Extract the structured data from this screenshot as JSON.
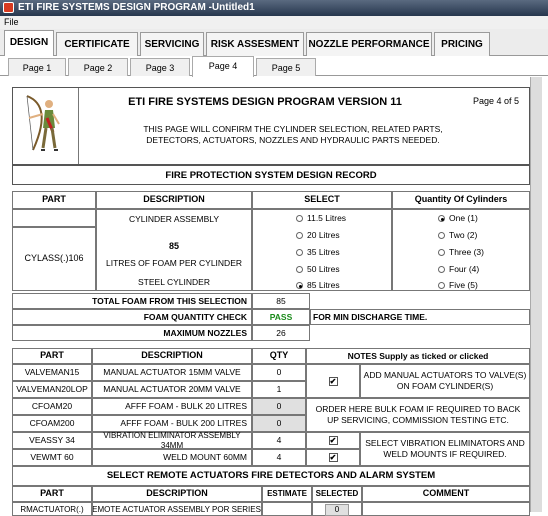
{
  "window": {
    "title": "ETI FIRE SYSTEMS DESIGN PROGRAM -Untitled1"
  },
  "menu": {
    "file": "File"
  },
  "main_tabs": [
    "DESIGN",
    "CERTIFICATE",
    "SERVICING",
    "RISK ASSESMENT",
    "NOZZLE PERFORMANCE",
    "PRICING"
  ],
  "sub_tabs": [
    "Page 1",
    "Page 2",
    "Page 3",
    "Page 4",
    "Page 5"
  ],
  "header": {
    "title": "ETI FIRE SYSTEMS DESIGN PROGRAM VERSION 11",
    "page_indicator": "Page 4 of 5",
    "intro": "THIS PAGE WILL CONFIRM THE CYLINDER SELECTION, RELATED PARTS, DETECTORS, ACTUATORS, NOZZLES AND HYDRAULIC PARTS NEEDED."
  },
  "record_title": "FIRE PROTECTION SYSTEM DESIGN RECORD",
  "cyl_table": {
    "headers": {
      "part": "PART",
      "description": "DESCRIPTION",
      "select": "SELECT",
      "qty": "Quantity Of Cylinders"
    },
    "part": "CYLASS(.)106",
    "desc_assembly": "CYLINDER ASSEMBLY",
    "desc_litres": "85",
    "desc_litres_label": "LITRES OF FOAM PER CYLINDER",
    "desc_steel": "STEEL CYLINDER",
    "sizes": [
      "11.5 Litres",
      "20 Litres",
      "35 Litres",
      "50 Litres",
      "85 Litres"
    ],
    "size_selected": 4,
    "quantities": [
      "One (1)",
      "Two (2)",
      "Three (3)",
      "Four (4)",
      "Five (5)"
    ],
    "qty_selected": 0
  },
  "summary": {
    "total_label": "TOTAL FOAM FROM THIS SELECTION",
    "total_value": "85",
    "check_label": "FOAM QUANTITY CHECK",
    "check_value": "PASS",
    "check_note": "FOR MIN DISCHARGE TIME.",
    "nozzles_label": "MAXIMUM NOZZLES",
    "nozzles_value": "26"
  },
  "parts_table": {
    "headers": {
      "part": "PART",
      "description": "DESCRIPTION",
      "qty": "QTY",
      "notes": "NOTES Supply as ticked or clicked"
    },
    "rows": [
      {
        "part": "VALVEMAN15",
        "description": "MANUAL ACTUATOR 15MM VALVE",
        "qty": "0"
      },
      {
        "part": "VALVEMAN20LOP",
        "description": "MANUAL ACTUATOR 20MM  VALVE",
        "qty": "1"
      },
      {
        "part": "CFOAM20",
        "description": "AFFF FOAM - BULK 20 LITRES",
        "qty": "0"
      },
      {
        "part": "CFOAM200",
        "description": "AFFF FOAM - BULK 200 LITRES",
        "qty": "0"
      },
      {
        "part": "VEASSY 34",
        "description": "VIBRATION ELIMINATOR ASSEMBLY 34MM",
        "qty": "4"
      },
      {
        "part": "VEWMT 60",
        "description": "WELD MOUNT 60MM",
        "qty": "4"
      }
    ],
    "note_actuators": "ADD MANUAL ACTUATORS TO VALVE(S) ON FOAM CYLINDER(S)",
    "note_foam": "ORDER HERE BULK FOAM IF REQUIRED TO BACK UP SERVICING, COMMISSION TESTING ETC.",
    "note_vibration": "SELECT VIBRATION ELIMINATORS AND WELD MOUNTS IF REQUIRED.",
    "check_mark": "✔"
  },
  "remote_section": {
    "title": "SELECT REMOTE ACTUATORS FIRE DETECTORS AND ALARM SYSTEM",
    "headers": {
      "part": "PART",
      "description": "DESCRIPTION",
      "estimate": "ESTIMATE",
      "selected": "SELECTED",
      "comment": "COMMENT"
    },
    "first_row": {
      "part": "RMACTUATOR(.)",
      "description": "REMOTE ACTUATOR ASSEMBLY POR SERIES II",
      "selected": "0"
    }
  }
}
